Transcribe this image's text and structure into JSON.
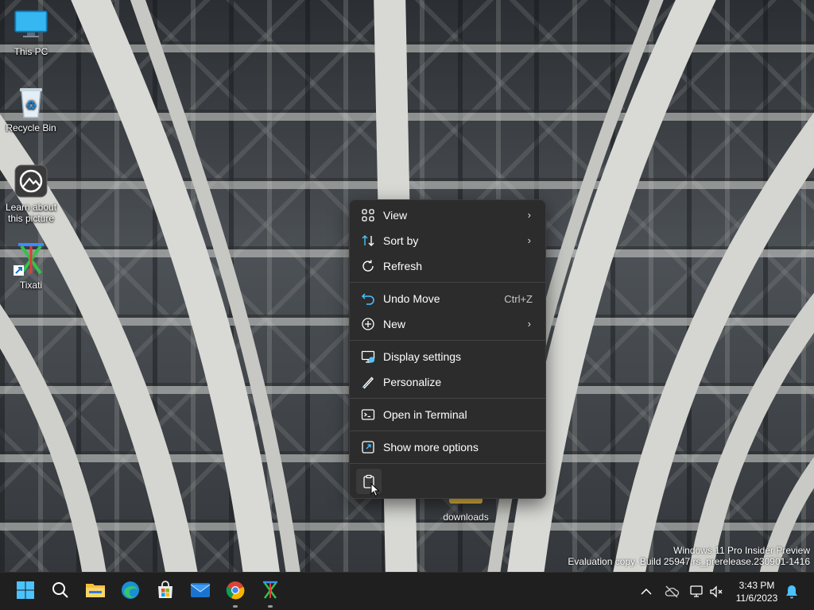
{
  "desktop": {
    "icons": [
      {
        "label": "This PC",
        "icon": "this-pc-icon"
      },
      {
        "label": "Recycle Bin",
        "icon": "recycle-bin-icon"
      },
      {
        "label": "Learn about this picture",
        "icon": "learn-about-picture-icon"
      },
      {
        "label": "Tixati",
        "icon": "tixati-icon"
      }
    ],
    "folder_label": "downloads"
  },
  "context_menu": {
    "items": [
      {
        "label": "View",
        "icon": "grid-view-icon",
        "has_submenu": true
      },
      {
        "label": "Sort by",
        "icon": "sort-icon",
        "has_submenu": true
      },
      {
        "label": "Refresh",
        "icon": "refresh-icon"
      },
      {
        "label": "Undo Move",
        "icon": "undo-icon",
        "shortcut": "Ctrl+Z"
      },
      {
        "label": "New",
        "icon": "new-plus-icon",
        "has_submenu": true
      },
      {
        "label": "Display settings",
        "icon": "display-settings-icon"
      },
      {
        "label": "Personalize",
        "icon": "pen-icon"
      },
      {
        "label": "Open in Terminal",
        "icon": "terminal-icon"
      },
      {
        "label": "Show more options",
        "icon": "show-more-options-icon"
      }
    ],
    "bottom_action_icon": "paste-icon",
    "chevron": "›"
  },
  "watermark": {
    "line1": "Windows 11 Pro Insider Preview",
    "line2": "Evaluation copy. Build 25947.rs_prerelease.230901-1416"
  },
  "taskbar": {
    "apps": [
      "start-icon",
      "search-icon",
      "file-explorer-icon",
      "edge-icon",
      "store-icon",
      "mail-icon",
      "chrome-icon",
      "tixati-icon"
    ],
    "tray": [
      "chevron-up-icon",
      "onedrive-icon",
      "network-icon",
      "volume-muted-icon",
      "notification-bell-icon"
    ],
    "time": "3:43 PM",
    "date": "11/6/2023"
  },
  "colors": {
    "menu_bg": "#2c2c2c",
    "taskbar_bg": "#1f1f1f",
    "accent": "#4cc2ff"
  }
}
